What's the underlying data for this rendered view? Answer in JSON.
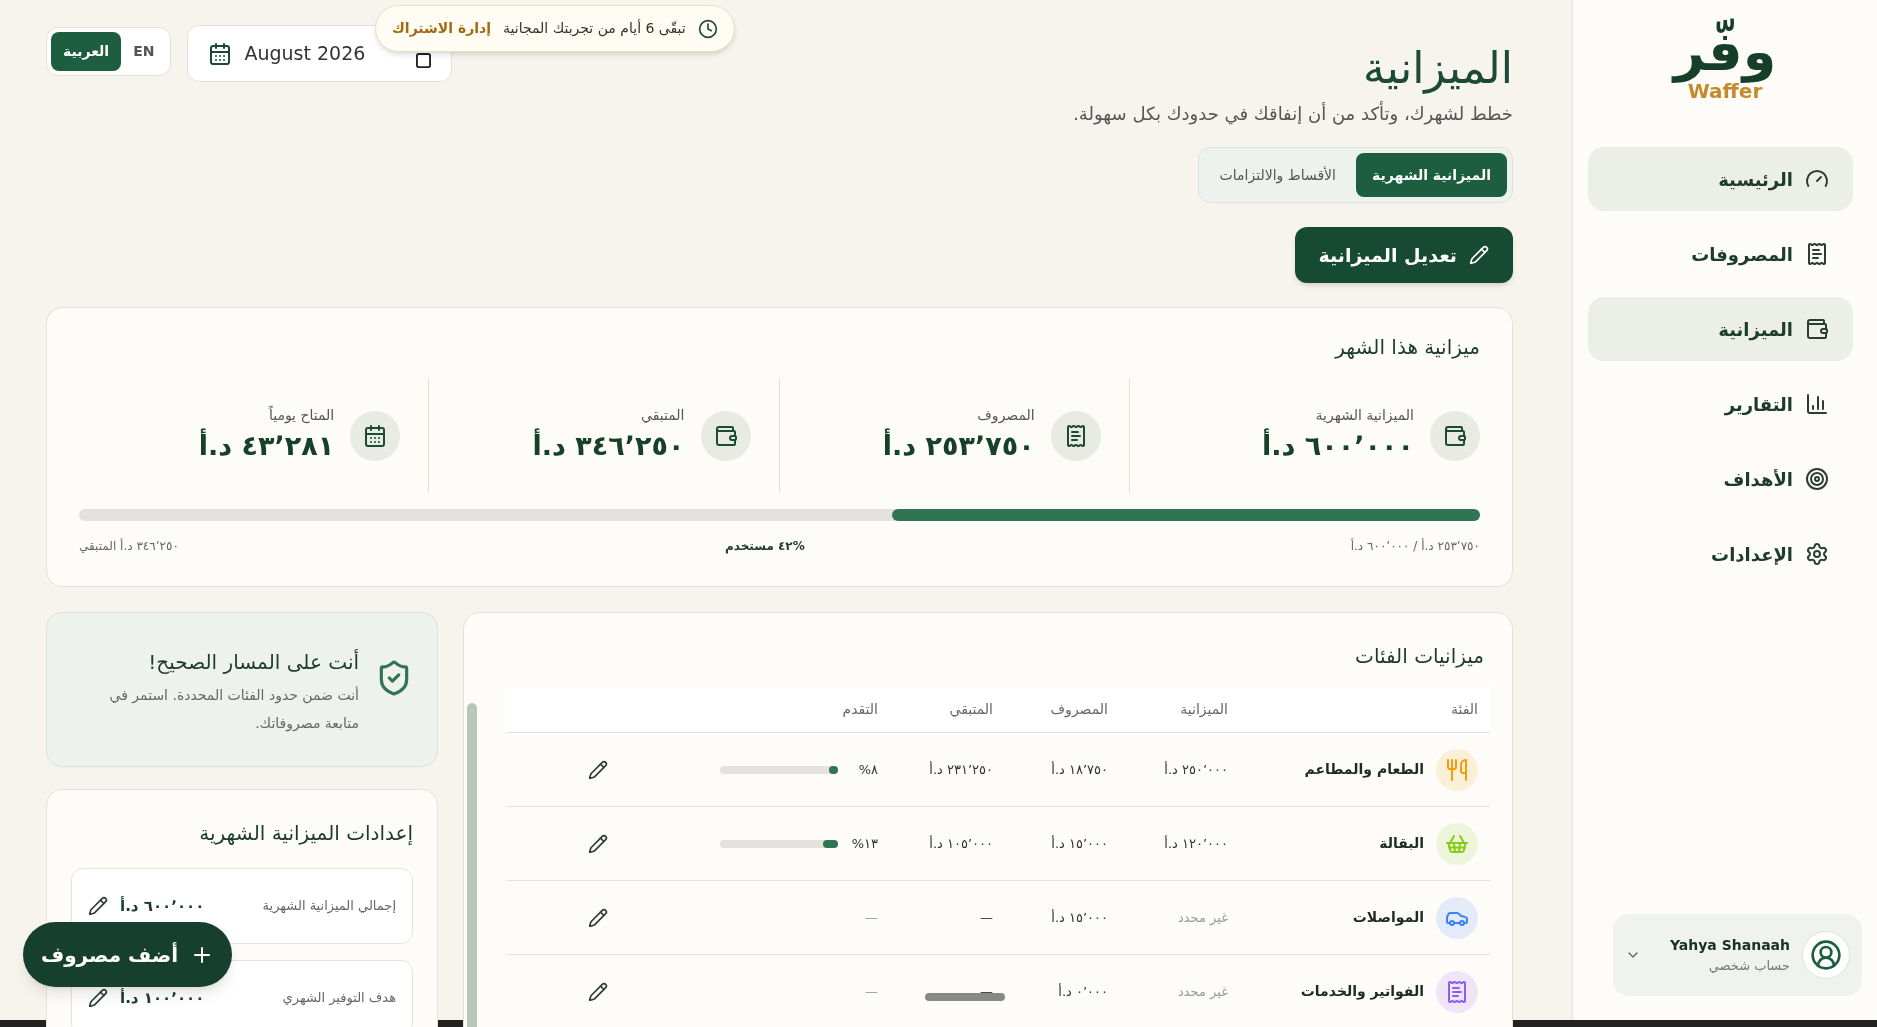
{
  "logo": {
    "mark": "وفّر",
    "name": "Waffer"
  },
  "sidebar": {
    "items": [
      {
        "label": "الرئيسية",
        "selected": true
      },
      {
        "label": "المصروفات",
        "selected": false
      },
      {
        "label": "الميزانية",
        "selected": true
      },
      {
        "label": "التقارير",
        "selected": false
      },
      {
        "label": "الأهداف",
        "selected": false
      },
      {
        "label": "الإعدادات",
        "selected": false
      }
    ]
  },
  "user": {
    "name": "Yahya Shanaah",
    "role": "حساب شخصي"
  },
  "header": {
    "title": "الميزانية",
    "subtitle": "خطط لشهرك، وتأكد من أن إنفاقك في حدودك بكل سهولة.",
    "tabs": [
      {
        "label": "الميزانية الشهرية",
        "selected": true
      },
      {
        "label": "الأقساط والالتزامات",
        "selected": false
      }
    ],
    "edit_button": "تعديل الميزانية"
  },
  "language": [
    {
      "label": "EN",
      "selected": false
    },
    {
      "label": "العربية",
      "selected": true
    }
  ],
  "month_picker": {
    "value": "August 2026"
  },
  "trial_banner": {
    "text": "تبقّى 6 أيام من تجربتك المجانية",
    "link": "إدارة الاشتراك"
  },
  "summary": {
    "title": "ميزانية هذا الشهر",
    "stats": [
      {
        "label": "الميزانية الشهرية",
        "value": "٦٠٠٬٠٠٠ د.أ"
      },
      {
        "label": "المصروف",
        "value": "٢٥٣٬٧٥٠ د.أ"
      },
      {
        "label": "المتبقي",
        "value": "٣٤٦٬٢٥٠ د.أ"
      },
      {
        "label": "المتاح يومياً",
        "value": "٤٣٬٢٨١ د.أ"
      }
    ],
    "level": 0.42,
    "spent_of_total": "٢٥٣٬٧٥٠ د.أ / ٦٠٠٬٠٠٠ د.أ",
    "used": "%٤٢ مستخدم",
    "remaining": "٣٤٦٬٢٥٠ د.أ المتبقي"
  },
  "categories": {
    "title": "ميزانيات الفئات",
    "columns": [
      "الفئة",
      "الميزانية",
      "المصروف",
      "المتبقي",
      "التقدم"
    ],
    "rows": [
      {
        "name": "الطعام والمطاعم",
        "color": "#f59e0b",
        "budget": "٢٥٠٬٠٠٠ د.أ",
        "budget_set": true,
        "spent": "١٨٬٧٥٠ د.أ",
        "remaining": "٢٣١٬٢٥٠ د.أ",
        "progress": {
          "level": 0.08,
          "label": "٨%"
        }
      },
      {
        "name": "البقالة",
        "color": "#84cc16",
        "budget": "١٢٠٬٠٠٠ د.أ",
        "budget_set": true,
        "spent": "١٥٬٠٠٠ د.أ",
        "remaining": "١٠٥٬٠٠٠ د.أ",
        "progress": {
          "level": 0.13,
          "label": "١٣%"
        }
      },
      {
        "name": "المواصلات",
        "color": "#3b82f6",
        "budget": "غير محدد",
        "budget_set": false,
        "spent": "١٥٬٠٠٠ د.أ",
        "remaining": "—",
        "progress_label": "—"
      },
      {
        "name": "الفواتير والخدمات",
        "color": "#8b5cf6",
        "budget": "غير محدد",
        "budget_set": false,
        "spent": "٠٬٠٠٠ د.أ",
        "remaining": "—",
        "progress_label": "—"
      }
    ]
  },
  "alert": {
    "title": "أنت على المسار الصحيح!",
    "text": "أنت ضمن حدود الفئات المحددة. استمر في متابعة مصروفاتك."
  },
  "settings": {
    "title": "إعدادات الميزانية الشهرية",
    "items": [
      {
        "label": "إجمالي الميزانية الشهرية",
        "value": "٦٠٠٬٠٠٠ د.أ"
      },
      {
        "label": "هدف التوفير الشهري",
        "value": "١٠٠٬٠٠٠ د.أ"
      }
    ]
  },
  "fab": {
    "label": "أضف مصروف"
  }
}
